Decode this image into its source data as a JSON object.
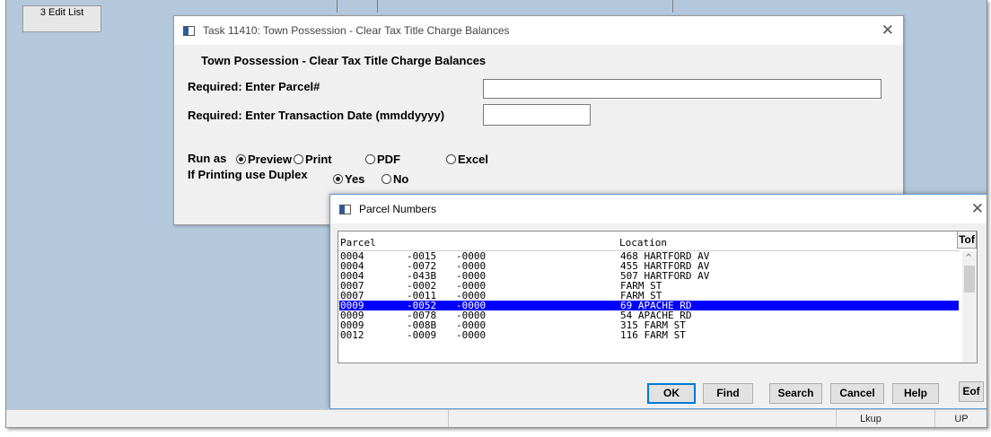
{
  "background": {
    "edit_list_button": "3 Edit List"
  },
  "status_bar": {
    "lookup": "Lkup",
    "mode": "UP"
  },
  "task_window": {
    "title": "Task 11410: Town Possession - Clear Tax Title Charge Balances",
    "heading": "Town Possession - Clear Tax Title Charge Balances",
    "parcel_label": "Required: Enter Parcel#",
    "parcel_value": "",
    "date_label": "Required: Enter Transaction Date (mmddyyyy)",
    "date_value": "",
    "run_as_label": "Run as",
    "run_as_options": [
      "Preview",
      "Print",
      "PDF",
      "Excel"
    ],
    "run_as_selected": "Preview",
    "duplex_label": "If Printing use Duplex",
    "duplex_options": [
      "Yes",
      "No"
    ],
    "duplex_selected": "Yes"
  },
  "parcel_window": {
    "title": "Parcel Numbers",
    "col_parcel": "Parcel",
    "col_location": "Location",
    "tof_label": "Tof",
    "eof_label": "Eof",
    "rows": [
      {
        "a": "0004",
        "b": "-0015",
        "c": "-0000",
        "location": "468 HARTFORD AV",
        "selected": false
      },
      {
        "a": "0004",
        "b": "-0072",
        "c": "-0000",
        "location": "455 HARTFORD AV",
        "selected": false
      },
      {
        "a": "0004",
        "b": "-043B",
        "c": "-0000",
        "location": "507 HARTFORD AV",
        "selected": false
      },
      {
        "a": "0007",
        "b": "-0002",
        "c": "-0000",
        "location": "FARM ST",
        "selected": false
      },
      {
        "a": "0007",
        "b": "-0011",
        "c": "-0000",
        "location": "FARM ST",
        "selected": false
      },
      {
        "a": "0009",
        "b": "-0052",
        "c": "-0000",
        "location": "69 APACHE RD",
        "selected": true
      },
      {
        "a": "0009",
        "b": "-0078",
        "c": "-0000",
        "location": "54 APACHE RD",
        "selected": false
      },
      {
        "a": "0009",
        "b": "-008B",
        "c": "-0000",
        "location": "315 FARM ST",
        "selected": false
      },
      {
        "a": "0012",
        "b": "-0009",
        "c": "-0000",
        "location": "116 FARM ST",
        "selected": false
      }
    ],
    "buttons": {
      "ok": "OK",
      "find": "Find",
      "search": "Search",
      "cancel": "Cancel",
      "help": "Help"
    }
  },
  "colors": {
    "selection": "#0000ff",
    "desktop": "#b4c8dd",
    "dialog_border": "#5b9bd5"
  },
  "icons": {
    "window_icon": "window-app-icon",
    "close": "close-icon"
  }
}
